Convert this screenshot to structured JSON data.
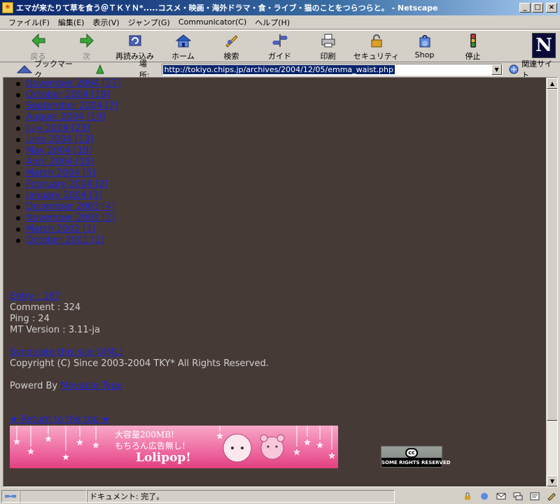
{
  "window": {
    "title": "エマが来たりて草を食う＠ＴＫＹＮ*.....コスメ・映画・海外ドラマ・食・ライブ・猫のことをつらつらと。 - Netscape",
    "controls": {
      "minimize": "_",
      "maximize": "□",
      "close": "×"
    }
  },
  "menu": [
    "ファイル(F)",
    "編集(E)",
    "表示(V)",
    "ジャンプ(G)",
    "Communicator(C)",
    "ヘルプ(H)"
  ],
  "toolbar": {
    "buttons": [
      {
        "label": "戻る",
        "icon": "back-arrow-icon",
        "enabled": false
      },
      {
        "label": "次",
        "icon": "forward-arrow-icon",
        "enabled": false
      },
      {
        "label": "再読み込み",
        "icon": "reload-icon",
        "enabled": true
      },
      {
        "label": "ホーム",
        "icon": "home-icon",
        "enabled": true
      },
      {
        "label": "検索",
        "icon": "search-icon",
        "enabled": true
      },
      {
        "label": "ガイド",
        "icon": "guide-icon",
        "enabled": true
      },
      {
        "label": "印刷",
        "icon": "print-icon",
        "enabled": true
      },
      {
        "label": "セキュリティ",
        "icon": "security-lock-icon",
        "enabled": true
      },
      {
        "label": "Shop",
        "icon": "shop-icon",
        "enabled": true
      },
      {
        "label": "停止",
        "icon": "stop-icon",
        "enabled": true
      }
    ],
    "logo": "N"
  },
  "location": {
    "bookmarks_label": "ブックマーク",
    "location_label": "場所:",
    "url": "http://tokiyo.chips.jp/archives/2004/12/05/emma_waist.php",
    "related_label": "関連サイト"
  },
  "page": {
    "archives": [
      "November 2004 [27]",
      "October 2004 [19]",
      "September 2004 [7]",
      "August 2004 [19]",
      "July 2004 [23]",
      "June 2004 [13]",
      "May 2004 [19]",
      "April 2004 [19]",
      "March 2004 [5]",
      "February 2004 [2]",
      "January 2004 [1]",
      "December 2003 [4]",
      "November 2003 [2]",
      "March 2002 [1]",
      "October 2001 [1]"
    ],
    "stats": {
      "entry": "Entry : 167",
      "comment": "Comment : 324",
      "ping": "Ping : 24",
      "mt_version": "MT Version : 3.11-ja"
    },
    "syndicate": "Syndicate this site (XML)",
    "copyright": "Copyright (C) Since 2003-2004 TKY* All Rights Reserved.",
    "powered_by": "Powerd By",
    "movable_type": "Movable Type",
    "return_top": "★ Return to the top ★",
    "banner": {
      "line1": "大容量200MB!",
      "line2": "もちろん広告無し!",
      "line3": "Lolipop!"
    },
    "cc_badge": {
      "symbol": "cc",
      "text": "SOME RIGHTS RESERVED"
    },
    "colors": {
      "background": "#463a36",
      "link": "#1d20e0",
      "text": "#cfcfcf"
    }
  },
  "status": {
    "text": "ドキュメント: 完了。"
  }
}
